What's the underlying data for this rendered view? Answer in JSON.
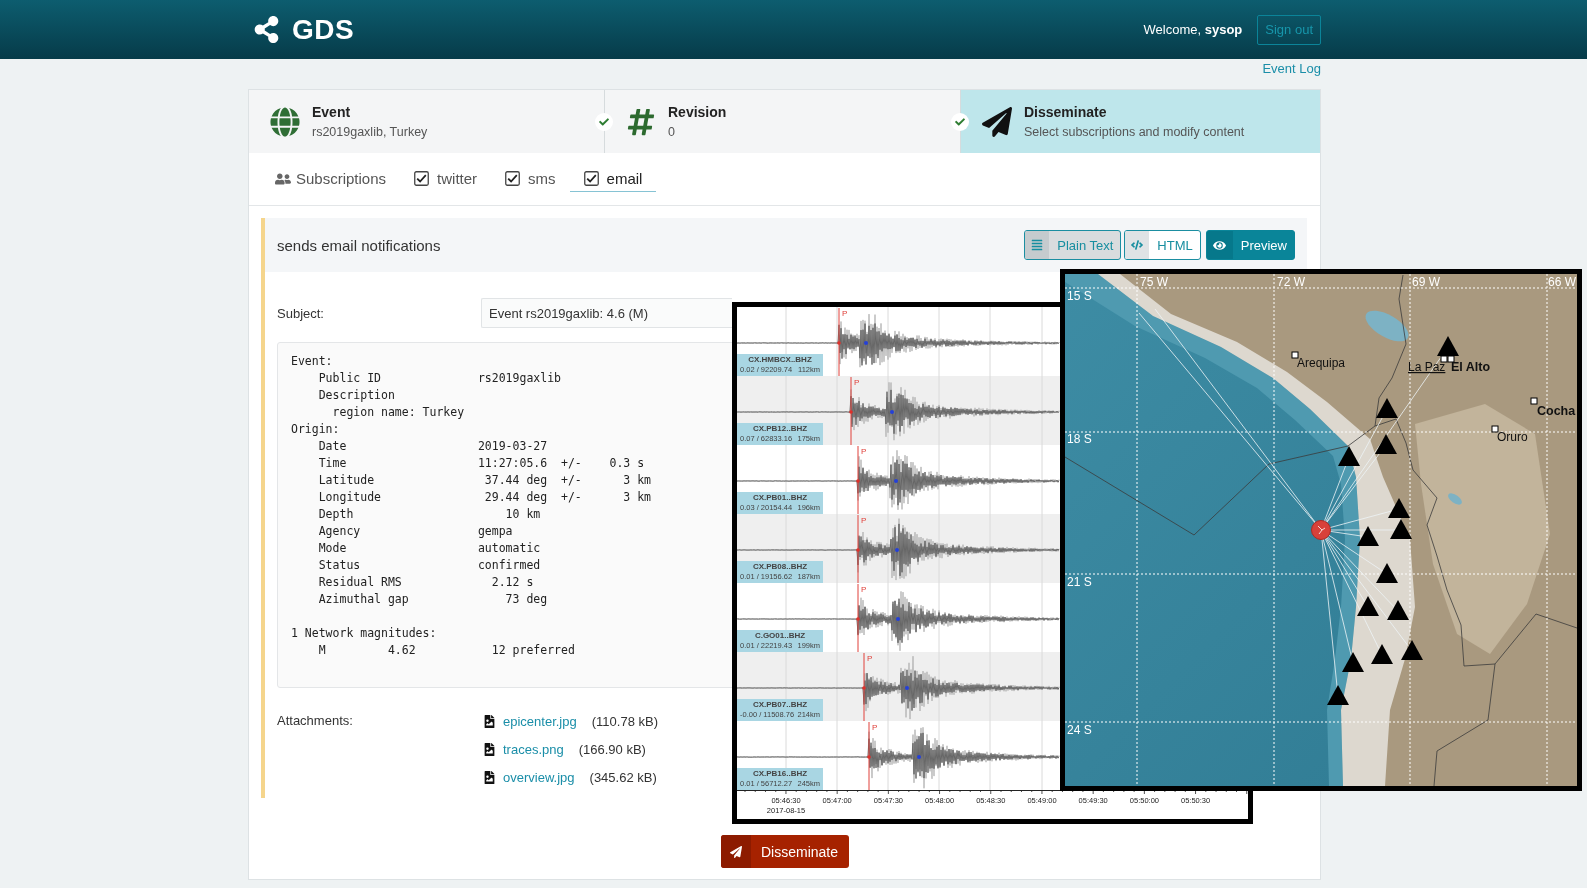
{
  "header": {
    "logo": "GDS",
    "welcome": "Welcome, **sysop**",
    "sign_out": "Sign out"
  },
  "event_log": "Event Log",
  "steps": [
    {
      "title": "Event",
      "subtitle": "rs2019gaxlib, Turkey",
      "done": true,
      "selected": false
    },
    {
      "title": "Revision",
      "subtitle": "0",
      "done": true,
      "selected": false
    },
    {
      "title": "Disseminate",
      "subtitle": "Select subscriptions and modify content",
      "done": false,
      "selected": true
    }
  ],
  "subscriptions": {
    "label": "Subscriptions",
    "tabs": [
      {
        "label": "twitter",
        "checked": true,
        "selected": false
      },
      {
        "label": "sms",
        "checked": true,
        "selected": false
      },
      {
        "label": "email",
        "checked": true,
        "selected": true
      }
    ]
  },
  "channel": {
    "description": "sends email notifications",
    "formats": [
      {
        "label": "Plain Text",
        "selected": true
      },
      {
        "label": "HTML",
        "selected": false
      }
    ],
    "preview": "Preview",
    "subject_label": "Subject:",
    "subject": "Event rs2019gaxlib: 4.6 (M)",
    "report": [
      [
        {
          "text": "Event:",
          "children": [
            {
              "text": "Public ID              rs2019gaxlib"
            },
            {
              "text": "Description",
              "children": [
                {
                  "text": "region name: Turkey"
                }
              ]
            }
          ]
        },
        {
          "text": "Origin:",
          "children": [
            {
              "text": "Date                   2019-03-27"
            },
            {
              "text": "Time                   11:27:05.6  +/-    0.3 s"
            },
            {
              "text": "Latitude                37.44 deg  +/-      3 km"
            },
            {
              "text": "Longitude               29.44 deg  +/-      3 km"
            },
            {
              "text": "Depth                      10 km"
            },
            {
              "text": "Agency                 gempa"
            },
            {
              "text": "Mode                   automatic"
            },
            {
              "text": "Status                 confirmed"
            },
            {
              "text": "Residual RMS             2.12 s"
            },
            {
              "text": "Azimuthal gap              73 deg"
            }
          ]
        }
      ],
      [
        {
          "text": "1 Network magnitudes:",
          "children": [
            {
              "text": "M         4.62           12 preferred"
            }
          ]
        }
      ]
    ],
    "attachments_label": "Attachments:",
    "attachments": [
      {
        "name": "epicenter.jpg",
        "size": "(110.78 kB)"
      },
      {
        "name": "traces.png",
        "size": "(166.90 kB)"
      },
      {
        "name": "overview.jpg",
        "size": "(345.62 kB)"
      }
    ]
  },
  "submit": "Disseminate",
  "seismogram": {
    "traces": [
      {
        "station": "CX.HMBCX..BHZ",
        "stats": "0.02 / 92209.74",
        "distance": "112km",
        "pick": "P"
      },
      {
        "station": "CX.PB12..BHZ",
        "stats": "0.07 / 62833.16",
        "distance": "175km",
        "pick": "P"
      },
      {
        "station": "CX.PB01..BHZ",
        "stats": "0.03 / 20154.44",
        "distance": "196km",
        "pick": "P"
      },
      {
        "station": "CX.PB08..BHZ",
        "stats": "0.01 / 19156.62",
        "distance": "187km",
        "pick": "P"
      },
      {
        "station": "C.GO01..BHZ",
        "stats": "0.01 / 22219.43",
        "distance": "199km",
        "pick": "P"
      },
      {
        "station": "CX.PB07..BHZ",
        "stats": "-0.00 / 11508.76",
        "distance": "214km",
        "pick": "P"
      },
      {
        "station": "CX.PB16..BHZ",
        "stats": "0.01 / 56712.27",
        "distance": "245km",
        "pick": "P"
      }
    ],
    "time_ticks": [
      "05:46:30",
      "05:47:00",
      "05:47:30",
      "05:48:00",
      "05:48:30",
      "05:49:00",
      "05:49:30",
      "05:50:00",
      "05:50:30"
    ],
    "date": "2017-08-15"
  },
  "map": {
    "lon_labels": [
      "75 W",
      "72 W",
      "69 W",
      "66 W"
    ],
    "lat_labels": [
      "15 S",
      "18 S",
      "21 S",
      "24 S"
    ],
    "cities": [
      {
        "name": "Arequipa",
        "kind": "city"
      },
      {
        "name": "La Paz",
        "kind": "capital"
      },
      {
        "name": "El Alto",
        "kind": "major"
      },
      {
        "name": "Cocha",
        "kind": "major"
      },
      {
        "name": "Oruro",
        "kind": "city"
      }
    ]
  }
}
